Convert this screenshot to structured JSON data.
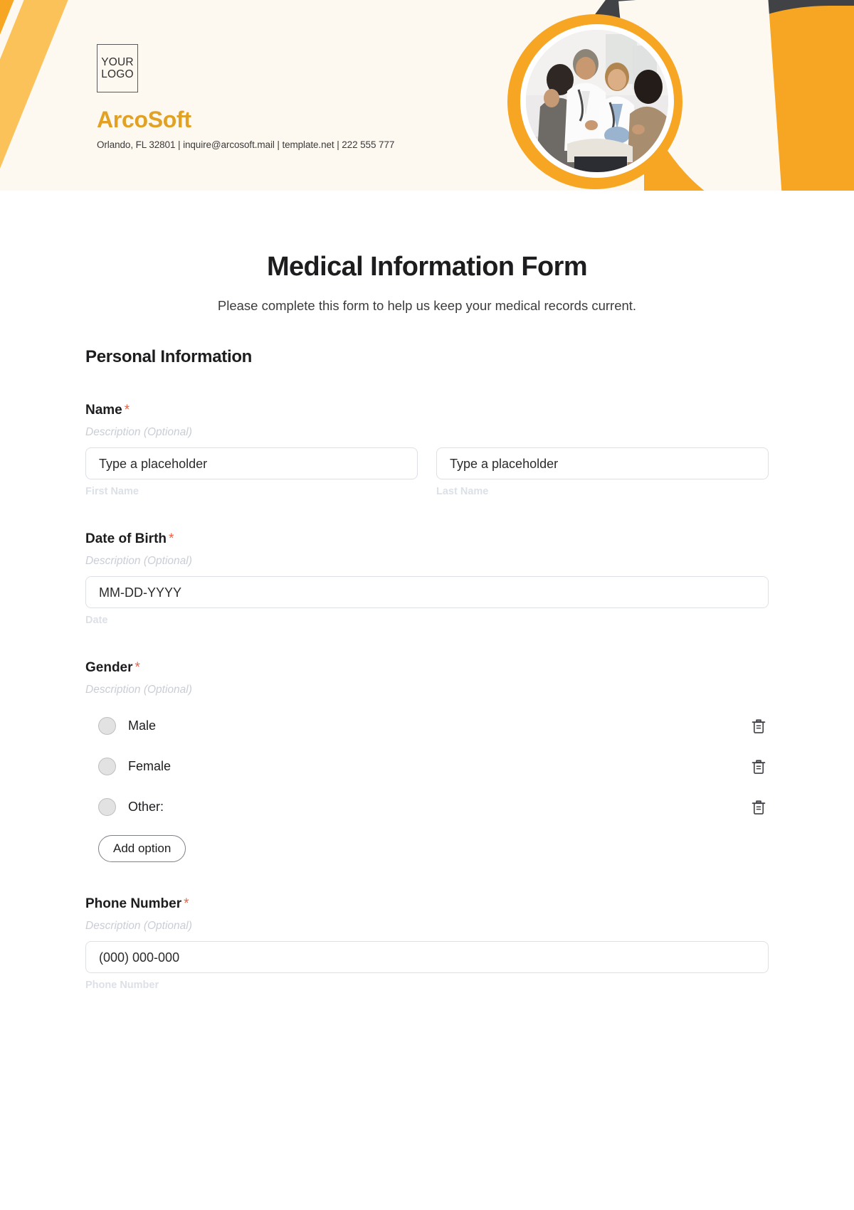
{
  "brand": {
    "logo_line_1": "YOUR",
    "logo_line_2": "LOGO",
    "name": "ArcoSoft",
    "contact": "Orlando, FL 32801 | inquire@arcosoft.mail | template.net | 222 555 777",
    "accent_color": "#F6A623",
    "brand_text_color": "#E0A124",
    "dark_shape_color": "#414246",
    "header_bg": "#FDF8F0"
  },
  "form": {
    "title": "Medical Information Form",
    "subtitle": "Please complete this form to help us keep your medical records current.",
    "section_title": "Personal Information",
    "required_marker": "*",
    "description_placeholder": "Description (Optional)",
    "fields": [
      {
        "label": "Name",
        "required": true,
        "description": "Description (Optional)",
        "inputs": [
          {
            "placeholder": "Type a placeholder",
            "sublabel": "First Name"
          },
          {
            "placeholder": "Type a placeholder",
            "sublabel": "Last Name"
          }
        ]
      },
      {
        "label": "Date of Birth",
        "required": true,
        "description": "Description (Optional)",
        "inputs": [
          {
            "placeholder": "MM-DD-YYYY",
            "sublabel": "Date"
          }
        ]
      },
      {
        "label": "Gender",
        "required": true,
        "description": "Description (Optional)",
        "options": [
          {
            "label": "Male",
            "selected": false,
            "delete_icon": "trash-icon"
          },
          {
            "label": "Female",
            "selected": false,
            "delete_icon": "trash-icon"
          },
          {
            "label": "Other:",
            "selected": false,
            "delete_icon": "trash-icon"
          }
        ],
        "add_option_label": "Add option"
      },
      {
        "label": "Phone Number",
        "required": true,
        "description": "Description (Optional)",
        "inputs": [
          {
            "placeholder": "(000) 000-000",
            "sublabel": "Phone Number"
          }
        ]
      }
    ]
  }
}
